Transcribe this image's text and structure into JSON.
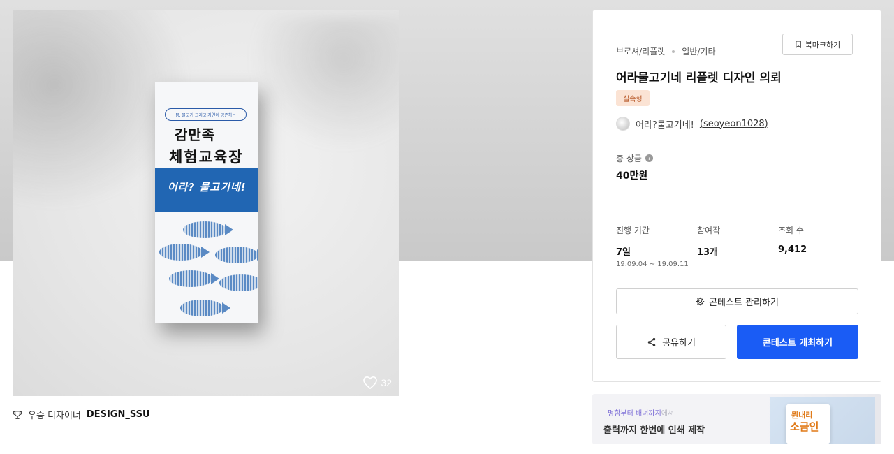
{
  "artwork": {
    "leaflet_small_text": "몸, 물고기 그리고 자연이 공존하는",
    "leaflet_title_line1": "감만족",
    "leaflet_title_line2": "체험교육장",
    "leaflet_banner": "어라? 물고기네!",
    "like_count": "32"
  },
  "winner": {
    "label": "우승 디자이너",
    "name": "DESIGN_SSU"
  },
  "panel": {
    "category1": "브로셔/리플렛",
    "category2": "일반/기타",
    "bookmark_label": "북마크하기",
    "title": "어라물고기네 리플렛 디자인 의뢰",
    "badge": "실속형",
    "author_name": "어라?물고기네!",
    "author_id": "(seoyeon1028)",
    "prize_label": "총 상금",
    "prize_value": "40만원",
    "stats": {
      "period_label": "진행 기간",
      "period_value": "7일",
      "period_range": "19.09.04 ~ 19.09.11",
      "entries_label": "참여작",
      "entries_value": "13개",
      "views_label": "조회 수",
      "views_value": "9,412"
    },
    "manage_label": "콘테스트 관리하기",
    "share_label": "공유하기",
    "host_label": "콘테스트 개최하기",
    "accent_color": "#1a5cf5"
  },
  "ad": {
    "line1_main": "명함부터 배너까지",
    "line1_fade": "에서",
    "line2_main": "출력까지 한번에 인쇄 제작",
    "product_text1": "뭔내리",
    "product_text2": "소금인"
  }
}
